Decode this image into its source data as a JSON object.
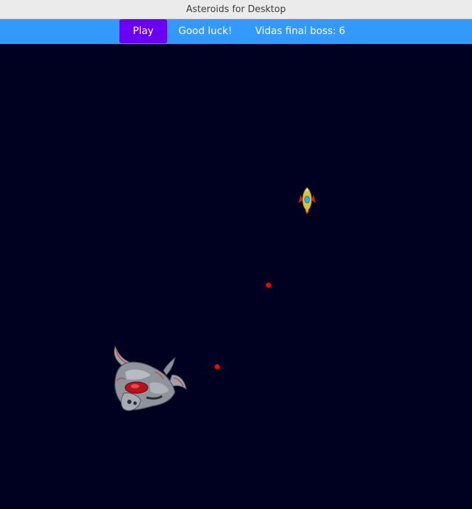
{
  "window": {
    "title": "Asteroids for Desktop"
  },
  "toolbar": {
    "play_label": "Play",
    "status_message": "Good luck!",
    "boss_lives_label": "Vidas final boss:",
    "boss_lives_value": "6"
  },
  "game": {
    "background_color": "#000020",
    "toolbar_color": "#3399ff",
    "play_button_color": "#6a00f4",
    "bullet_color": "#ff0000",
    "sprites": [
      "player-ship-icon",
      "final-boss-icon",
      "bullet-icon"
    ]
  }
}
